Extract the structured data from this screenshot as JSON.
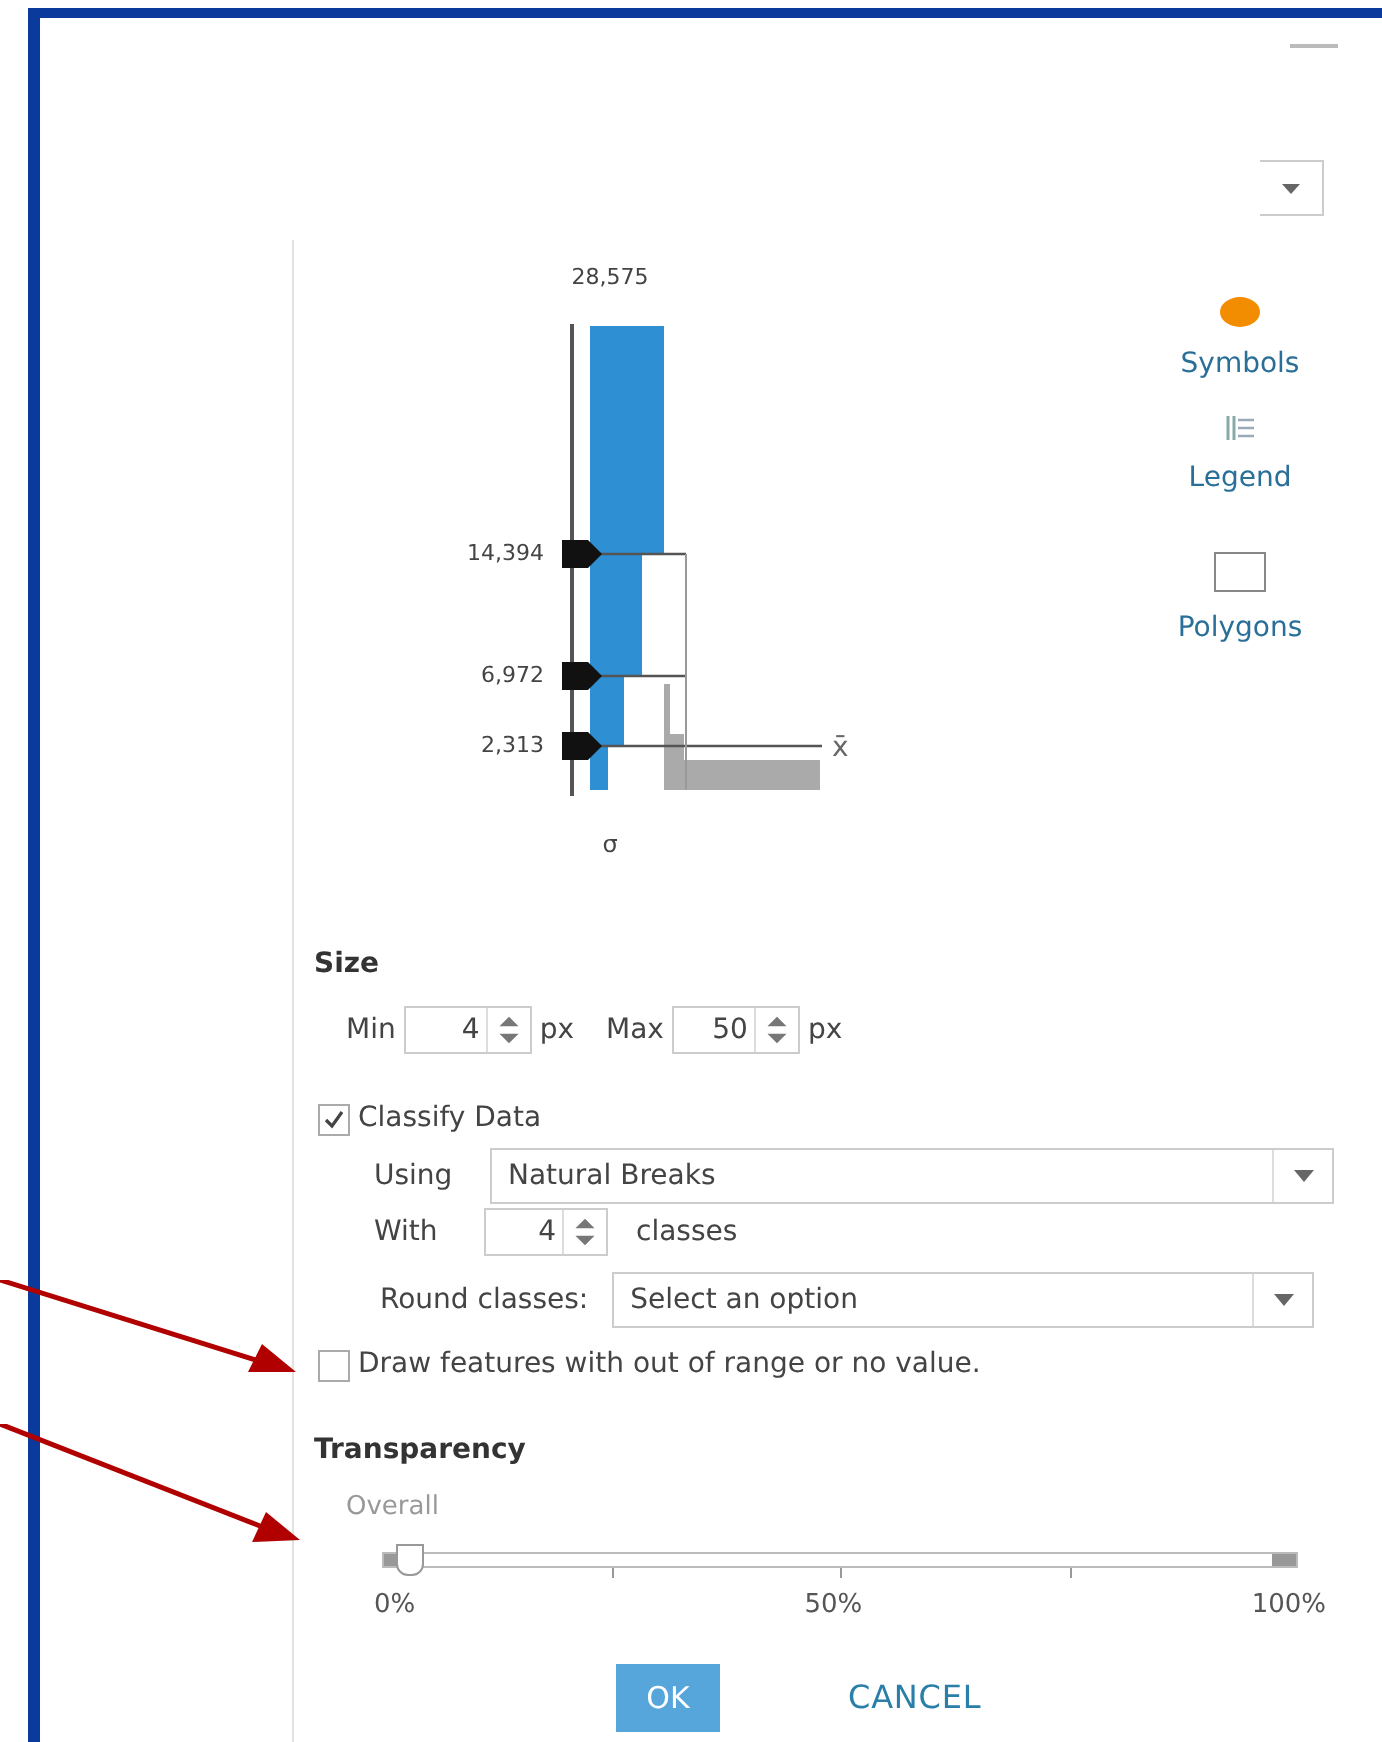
{
  "histogram": {
    "max_label": "28,575",
    "breaks": [
      {
        "label": "14,394"
      },
      {
        "label": "6,972"
      },
      {
        "label": "2,313"
      }
    ],
    "sigma_label": "σ",
    "mean_label": "x̄"
  },
  "side_tabs": [
    {
      "label": "Symbols",
      "kind": "symbol"
    },
    {
      "label": "Legend",
      "kind": "legend"
    },
    {
      "label": "Polygons",
      "kind": "polygon"
    }
  ],
  "size": {
    "title": "Size",
    "min_label": "Min",
    "min_value": "4",
    "min_unit": "px",
    "max_label": "Max",
    "max_value": "50",
    "max_unit": "px"
  },
  "classify": {
    "label": "Classify Data",
    "checked": true,
    "using_label": "Using",
    "using_value": "Natural Breaks",
    "with_label": "With",
    "with_value": "4",
    "with_unit": "classes",
    "round_label": "Round classes:",
    "round_placeholder": "Select an option"
  },
  "draw_out_of_range": {
    "label": "Draw features with out of range or no value.",
    "checked": false
  },
  "transparency": {
    "title": "Transparency",
    "sublabel": "Overall",
    "level": 0,
    "ticks": [
      "0%",
      "50%",
      "100%"
    ]
  },
  "buttons": [
    {
      "label": "OK",
      "kind": "primary"
    },
    {
      "label": "CANCEL",
      "kind": "link"
    }
  ]
}
